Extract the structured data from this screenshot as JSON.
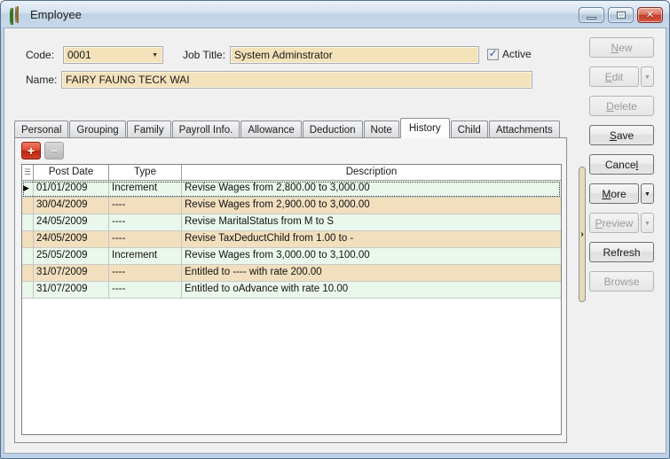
{
  "window": {
    "title": "Employee"
  },
  "form": {
    "code_label": "Code:",
    "code_value": "0001",
    "job_title_label": "Job Title:",
    "job_title_value": "System Adminstrator",
    "active_label": "Active",
    "active_checked": true,
    "name_label": "Name:",
    "name_value": "FAIRY FAUNG TECK WAI"
  },
  "tabs": {
    "active": "History",
    "items": [
      {
        "label": "Personal"
      },
      {
        "label": "Grouping"
      },
      {
        "label": "Family"
      },
      {
        "label": "Payroll Info."
      },
      {
        "label": "Allowance"
      },
      {
        "label": "Deduction"
      },
      {
        "label": "Note"
      },
      {
        "label": "History"
      },
      {
        "label": "Child"
      },
      {
        "label": "Attachments"
      }
    ]
  },
  "toolbar": {
    "add_glyph": "+",
    "remove_glyph": "−"
  },
  "grid": {
    "columns": [
      "Post Date",
      "Type",
      "Description"
    ],
    "rows": [
      {
        "post_date": "01/01/2009",
        "type": "Increment",
        "description": "Revise Wages from 2,800.00 to 3,000.00",
        "selected": true
      },
      {
        "post_date": "30/04/2009",
        "type": "----",
        "description": "Revise Wages from 2,900.00 to 3,000.00",
        "selected": false
      },
      {
        "post_date": "24/05/2009",
        "type": "----",
        "description": "Revise MaritalStatus from M to S",
        "selected": false
      },
      {
        "post_date": "24/05/2009",
        "type": "----",
        "description": "Revise TaxDeductChild from 1.00 to -",
        "selected": false
      },
      {
        "post_date": "25/05/2009",
        "type": "Increment",
        "description": "Revise Wages from 3,000.00 to 3,100.00",
        "selected": false
      },
      {
        "post_date": "31/07/2009",
        "type": "----",
        "description": "Entitled to ---- with rate 200.00",
        "selected": false
      },
      {
        "post_date": "31/07/2009",
        "type": "----",
        "description": "Entitled to oAdvance with rate 10.00",
        "selected": false
      }
    ]
  },
  "side_buttons": [
    {
      "name": "new",
      "pre": "",
      "accel": "N",
      "post": "ew",
      "enabled": false,
      "split": false
    },
    {
      "name": "edit",
      "pre": "",
      "accel": "E",
      "post": "dit",
      "enabled": false,
      "split": true
    },
    {
      "name": "delete",
      "pre": "",
      "accel": "D",
      "post": "elete",
      "enabled": false,
      "split": false
    },
    {
      "name": "save",
      "pre": "",
      "accel": "S",
      "post": "ave",
      "enabled": true,
      "split": false
    },
    {
      "name": "cancel",
      "pre": "Cance",
      "accel": "l",
      "post": "",
      "enabled": true,
      "split": false
    },
    {
      "name": "more",
      "pre": "",
      "accel": "M",
      "post": "ore",
      "enabled": true,
      "split": true
    },
    {
      "name": "preview",
      "pre": "",
      "accel": "P",
      "post": "review",
      "enabled": false,
      "split": true
    },
    {
      "name": "refresh",
      "pre": "Refresh",
      "accel": "",
      "post": "",
      "enabled": true,
      "split": false
    },
    {
      "name": "browse",
      "pre": "Browse",
      "accel": "",
      "post": "",
      "enabled": false,
      "split": false
    }
  ],
  "icons": {
    "dropdown": "▼",
    "split_arrow": "▼",
    "check": "✓",
    "row_pointer": "▶",
    "list": "☰",
    "splitter_chevron": "›",
    "close": "✕"
  },
  "colors": {
    "frame": "#BDD2E6",
    "frame_dark": "#56708C",
    "field_bg": "#F3E2BA",
    "row_green": "#EAF8EB",
    "row_tan": "#F2DFBE",
    "splitter": "#E6DCBB",
    "accent_check": "#2C55B2",
    "add_button_red": "#C93A24",
    "close_button_red": "#C23C28"
  }
}
